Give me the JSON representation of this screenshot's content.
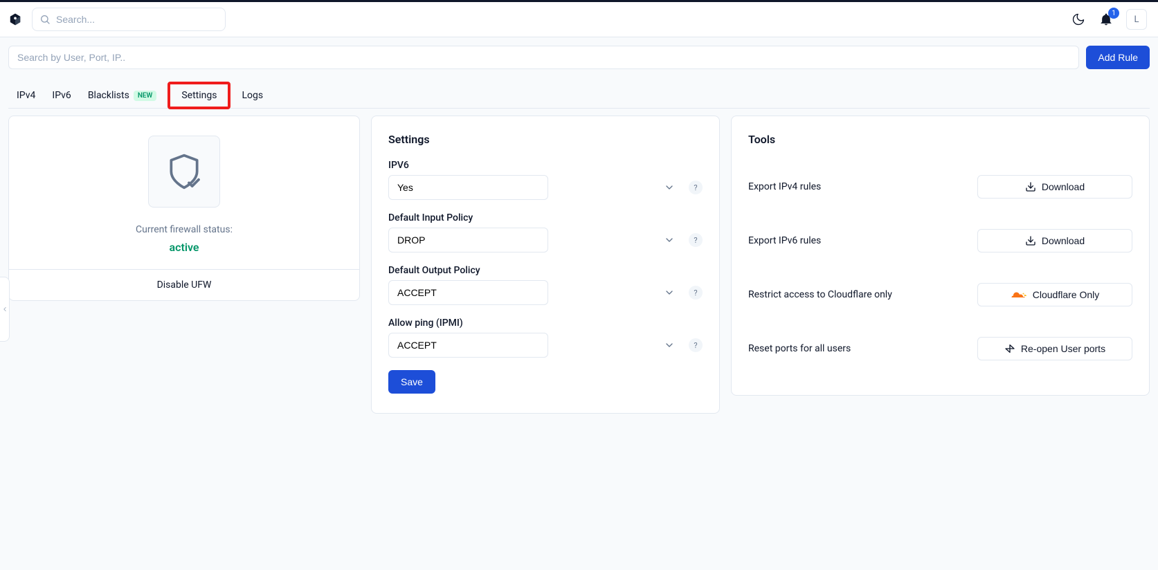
{
  "header": {
    "search_placeholder": "Search...",
    "notification_count": "1",
    "avatar_initial": "L"
  },
  "filter": {
    "placeholder": "Search by User, Port, IP..",
    "add_rule_label": "Add Rule"
  },
  "tabs": {
    "ipv4": "IPv4",
    "ipv6": "IPv6",
    "blacklists": "Blacklists",
    "blacklists_badge": "NEW",
    "settings": "Settings",
    "logs": "Logs"
  },
  "status": {
    "label": "Current firewall status:",
    "value": "active",
    "disable_label": "Disable UFW"
  },
  "settings": {
    "title": "Settings",
    "ipv6": {
      "label": "IPV6",
      "value": "Yes"
    },
    "input_policy": {
      "label": "Default Input Policy",
      "value": "DROP"
    },
    "output_policy": {
      "label": "Default Output Policy",
      "value": "ACCEPT"
    },
    "allow_ping": {
      "label": "Allow ping (IPMI)",
      "value": "ACCEPT"
    },
    "save_label": "Save",
    "help_char": "?"
  },
  "tools": {
    "title": "Tools",
    "rows": [
      {
        "label": "Export IPv4 rules",
        "button": "Download",
        "icon": "download"
      },
      {
        "label": "Export IPv6 rules",
        "button": "Download",
        "icon": "download"
      },
      {
        "label": "Restrict access to Cloudflare only",
        "button": "Cloudflare Only",
        "icon": "cloud"
      },
      {
        "label": "Reset ports for all users",
        "button": "Re-open User ports",
        "icon": "reset"
      }
    ]
  }
}
